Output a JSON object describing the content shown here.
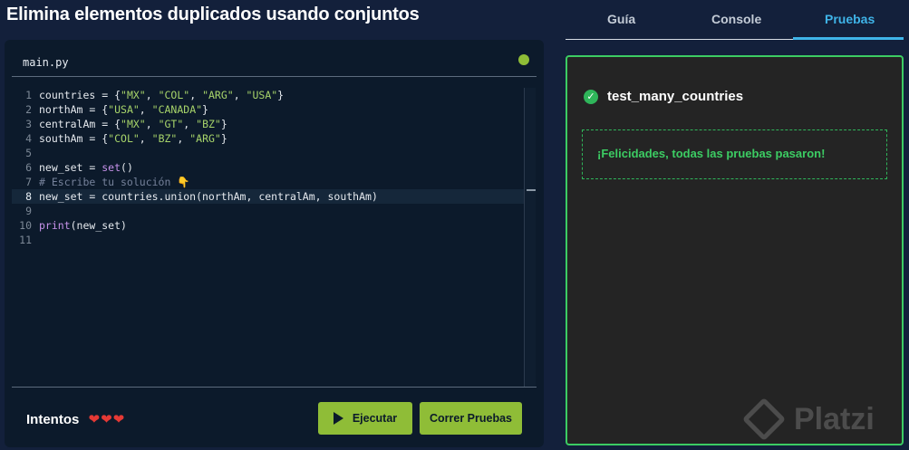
{
  "page_title": "Elimina elementos duplicados usando conjuntos",
  "editor": {
    "filename": "main.py",
    "lines": [
      {
        "n": "1",
        "tokens": [
          [
            "t",
            "countries = {"
          ],
          [
            "s",
            "\"MX\""
          ],
          [
            "t",
            ", "
          ],
          [
            "s",
            "\"COL\""
          ],
          [
            "t",
            ", "
          ],
          [
            "s",
            "\"ARG\""
          ],
          [
            "t",
            ", "
          ],
          [
            "s",
            "\"USA\""
          ],
          [
            "t",
            "}"
          ]
        ]
      },
      {
        "n": "2",
        "tokens": [
          [
            "t",
            "northAm = {"
          ],
          [
            "s",
            "\"USA\""
          ],
          [
            "t",
            ", "
          ],
          [
            "s",
            "\"CANADA\""
          ],
          [
            "t",
            "}"
          ]
        ]
      },
      {
        "n": "3",
        "tokens": [
          [
            "t",
            "centralAm = {"
          ],
          [
            "s",
            "\"MX\""
          ],
          [
            "t",
            ", "
          ],
          [
            "s",
            "\"GT\""
          ],
          [
            "t",
            ", "
          ],
          [
            "s",
            "\"BZ\""
          ],
          [
            "t",
            "}"
          ]
        ]
      },
      {
        "n": "4",
        "tokens": [
          [
            "t",
            "southAm = {"
          ],
          [
            "s",
            "\"COL\""
          ],
          [
            "t",
            ", "
          ],
          [
            "s",
            "\"BZ\""
          ],
          [
            "t",
            ", "
          ],
          [
            "s",
            "\"ARG\""
          ],
          [
            "t",
            "}"
          ]
        ]
      },
      {
        "n": "5",
        "tokens": []
      },
      {
        "n": "6",
        "tokens": [
          [
            "t",
            "new_set = "
          ],
          [
            "f",
            "set"
          ],
          [
            "t",
            "()"
          ]
        ]
      },
      {
        "n": "7",
        "tokens": [
          [
            "c",
            "# Escribe tu solución 👇"
          ]
        ]
      },
      {
        "n": "8",
        "tokens": [
          [
            "t",
            "new_set = countries.union(northAm, centralAm, southAm)"
          ]
        ],
        "active": true
      },
      {
        "n": "9",
        "tokens": []
      },
      {
        "n": "10",
        "tokens": [
          [
            "f",
            "print"
          ],
          [
            "t",
            "(new_set)"
          ]
        ]
      },
      {
        "n": "11",
        "tokens": []
      }
    ]
  },
  "footer": {
    "attempts_label": "Intentos",
    "hearts": "❤❤❤",
    "run_label": "Ejecutar",
    "tests_label": "Correr Pruebas"
  },
  "tabs": {
    "guia": "Guía",
    "console": "Console",
    "pruebas": "Pruebas",
    "active": "pruebas"
  },
  "results": {
    "test_name": "test_many_countries",
    "status": "passed",
    "message": "¡Felicidades, todas las pruebas pasaron!"
  },
  "watermark": "Platzi",
  "colors": {
    "accent_green": "#8fbd37",
    "success_green": "#3ccc63",
    "tab_active": "#3fb4e8"
  }
}
